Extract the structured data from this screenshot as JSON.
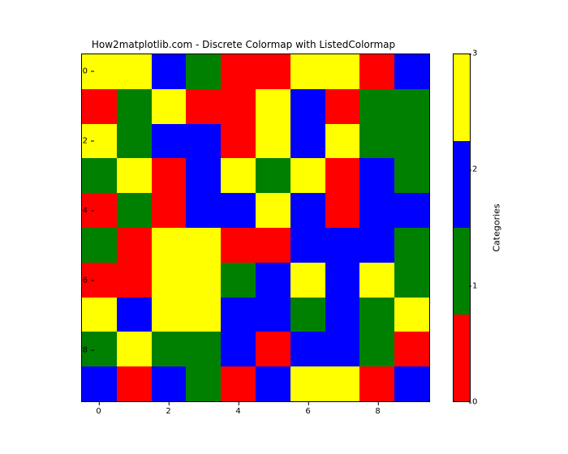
{
  "chart_data": {
    "type": "heatmap",
    "title": "How2matplotlib.com - Discrete Colormap with ListedColormap",
    "xlabel": "",
    "ylabel": "",
    "xticks": [
      0,
      2,
      4,
      6,
      8
    ],
    "yticks": [
      0,
      2,
      4,
      6,
      8
    ],
    "xlim": [
      -0.5,
      9.5
    ],
    "ylim": [
      9.5,
      -0.5
    ],
    "nrows": 10,
    "ncols": 10,
    "colormap": [
      "#ff0000",
      "#008000",
      "#0000ff",
      "#ffff00"
    ],
    "grid": [
      [
        3,
        3,
        2,
        1,
        0,
        0,
        3,
        3,
        0,
        2
      ],
      [
        0,
        1,
        3,
        0,
        0,
        3,
        2,
        0,
        1,
        1
      ],
      [
        3,
        1,
        2,
        2,
        0,
        3,
        2,
        3,
        1,
        1
      ],
      [
        1,
        3,
        0,
        2,
        3,
        1,
        3,
        0,
        2,
        1
      ],
      [
        0,
        1,
        0,
        2,
        2,
        3,
        2,
        0,
        2,
        2
      ],
      [
        1,
        0,
        3,
        3,
        0,
        0,
        2,
        2,
        2,
        1
      ],
      [
        0,
        0,
        3,
        3,
        1,
        2,
        3,
        2,
        3,
        1
      ],
      [
        3,
        2,
        3,
        3,
        2,
        2,
        1,
        2,
        1,
        3
      ],
      [
        1,
        3,
        1,
        1,
        2,
        0,
        2,
        2,
        1,
        0
      ],
      [
        2,
        0,
        2,
        1,
        0,
        2,
        3,
        3,
        0,
        2
      ]
    ],
    "colorbar": {
      "label": "Categories",
      "ticks": [
        0,
        1,
        2,
        3
      ],
      "range": [
        0,
        3
      ]
    }
  }
}
